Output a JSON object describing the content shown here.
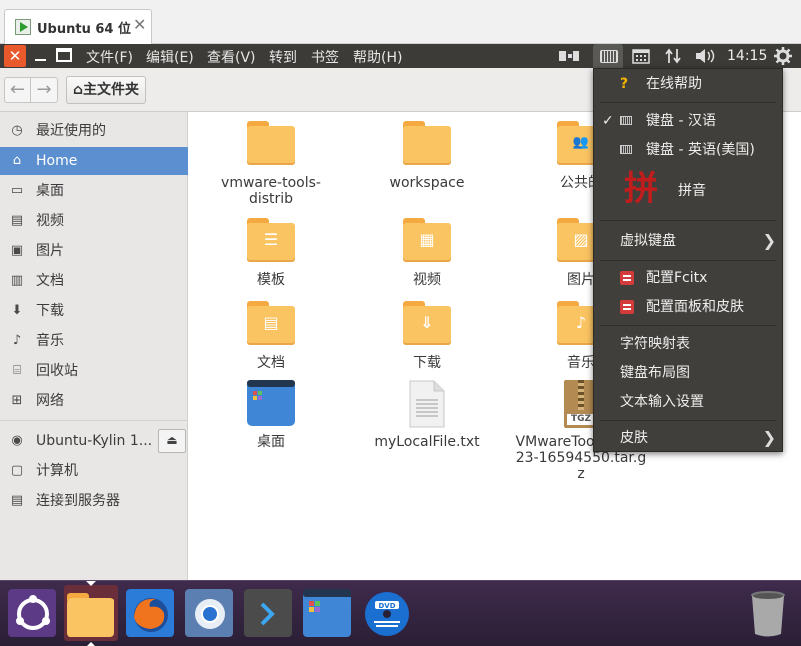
{
  "vm_tab": {
    "title": "Ubuntu 64 位",
    "close_glyph": "✕"
  },
  "topbar": {
    "close_glyph": "✕",
    "menus": [
      "文件(F)",
      "编辑(E)",
      "查看(V)",
      "转到",
      "书签",
      "帮助(H)"
    ],
    "clock": "14:15"
  },
  "toolbar": {
    "back_glyph": "←",
    "forward_glyph": "→",
    "home_crumb": "主文件夹",
    "home_glyph": "⌂"
  },
  "sidebar": {
    "items": [
      {
        "label": "最近使用的",
        "icon": "clock-icon",
        "glyph": "◷"
      },
      {
        "label": "Home",
        "icon": "home-icon",
        "glyph": "⌂",
        "active": true
      },
      {
        "label": "桌面",
        "icon": "desktop-icon",
        "glyph": "▭"
      },
      {
        "label": "视频",
        "icon": "video-icon",
        "glyph": "▤"
      },
      {
        "label": "图片",
        "icon": "picture-icon",
        "glyph": "▣"
      },
      {
        "label": "文档",
        "icon": "document-icon",
        "glyph": "▥"
      },
      {
        "label": "下载",
        "icon": "download-icon",
        "glyph": "⬇"
      },
      {
        "label": "音乐",
        "icon": "music-icon",
        "glyph": "♪"
      },
      {
        "label": "回收站",
        "icon": "trash-icon",
        "glyph": "⌸"
      },
      {
        "label": "网络",
        "icon": "network-icon",
        "glyph": "⊞"
      },
      {
        "label": "Ubuntu-Kylin 1...",
        "icon": "disc-icon",
        "glyph": "◉"
      },
      {
        "label": "计算机",
        "icon": "computer-icon",
        "glyph": "▢"
      },
      {
        "label": "连接到服务器",
        "icon": "server-icon",
        "glyph": "▤"
      }
    ],
    "eject_glyph": "⏏"
  },
  "files": [
    {
      "name": "vmware-tools-distrib",
      "kind": "folder",
      "glyph": ""
    },
    {
      "name": "workspace",
      "kind": "folder",
      "glyph": ""
    },
    {
      "name": "公共的",
      "kind": "folder",
      "glyph": "👥"
    },
    {
      "name": "模板",
      "kind": "folder",
      "glyph": "☰"
    },
    {
      "name": "视频",
      "kind": "folder",
      "glyph": "▦"
    },
    {
      "name": "图片",
      "kind": "folder",
      "glyph": "▨"
    },
    {
      "name": "文档",
      "kind": "folder",
      "glyph": "▤"
    },
    {
      "name": "下载",
      "kind": "folder",
      "glyph": "⇓"
    },
    {
      "name": "音乐",
      "kind": "folder",
      "glyph": "♪"
    },
    {
      "name": "桌面",
      "kind": "desktop",
      "glyph": ""
    },
    {
      "name": "myLocalFile.txt",
      "kind": "text",
      "glyph": ""
    },
    {
      "name": "VMwareTools-10.3.23-16594550.tar.gz",
      "kind": "archive",
      "glyph": "TGZ"
    }
  ],
  "dropdown": {
    "help": "在线帮助",
    "help_glyph": "?",
    "kbd_cn": "键盘 - 汉语",
    "check_glyph": "✓",
    "kbd_en": "键盘 - 英语(美国)",
    "pinyin": "拼音",
    "pinyin_glyph": "拼",
    "virtual_kbd": "虚拟键盘",
    "config_fcitx": "配置Fcitx",
    "config_panel": "配置面板和皮肤",
    "charmap": "字符映射表",
    "kbd_layout": "键盘布局图",
    "text_input": "文本输入设置",
    "skin": "皮肤",
    "chevron": "❯"
  },
  "launcher": {
    "apps": [
      "dash-icon",
      "files-icon",
      "firefox-icon",
      "chromium-icon",
      "terminal-icon",
      "desktop-app-icon",
      "dvd-icon"
    ],
    "trash": "trash-icon"
  }
}
